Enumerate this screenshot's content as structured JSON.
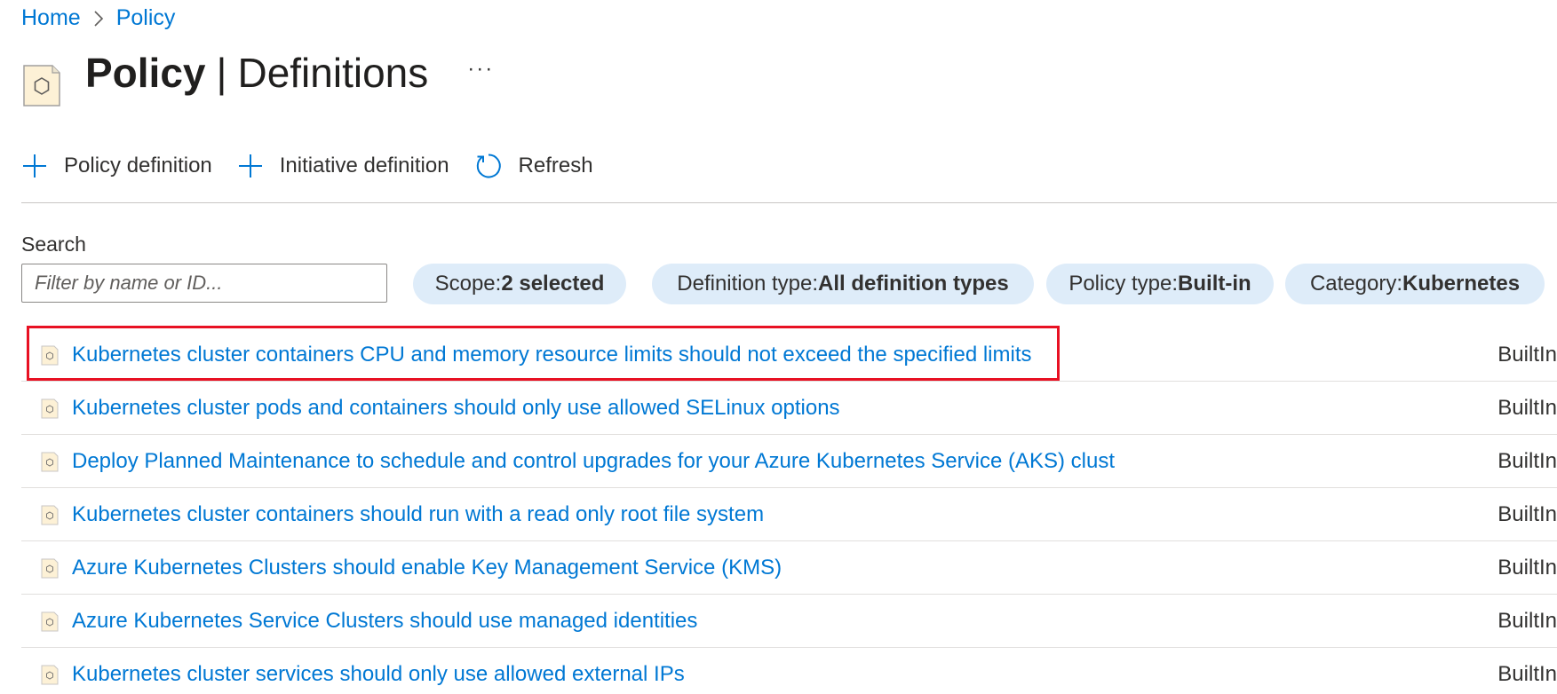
{
  "breadcrumb": {
    "home": "Home",
    "current": "Policy"
  },
  "header": {
    "title_bold": "Policy",
    "title_separator": "|",
    "title_rest": "Definitions",
    "more": "···",
    "icon": "policy-icon"
  },
  "toolbar": {
    "policy_definition": "Policy definition",
    "initiative_definition": "Initiative definition",
    "refresh": "Refresh"
  },
  "search": {
    "label": "Search",
    "placeholder": "Filter by name or ID..."
  },
  "filters": [
    {
      "name": "Scope",
      "sep": " : ",
      "value": "2 selected"
    },
    {
      "name": "Definition type",
      "sep": " : ",
      "value": "All definition types"
    },
    {
      "name": "Policy type",
      "sep": " : ",
      "value": "Built-in"
    },
    {
      "name": "Category",
      "sep": " : ",
      "value": "Kubernetes"
    }
  ],
  "definitions": [
    {
      "name": "Kubernetes cluster containers CPU and memory resource limits should not exceed the specified limits",
      "type": "BuiltIn",
      "highlighted": true
    },
    {
      "name": "Kubernetes cluster pods and containers should only use allowed SELinux options",
      "type": "BuiltIn"
    },
    {
      "name": "Deploy Planned Maintenance to schedule and control upgrades for your Azure Kubernetes Service (AKS) clust",
      "type": "BuiltIn"
    },
    {
      "name": "Kubernetes cluster containers should run with a read only root file system",
      "type": "BuiltIn"
    },
    {
      "name": "Azure Kubernetes Clusters should enable Key Management Service (KMS)",
      "type": "BuiltIn"
    },
    {
      "name": "Azure Kubernetes Service Clusters should use managed identities",
      "type": "BuiltIn"
    },
    {
      "name": "Kubernetes cluster services should only use allowed external IPs",
      "type": "BuiltIn"
    }
  ],
  "colors": {
    "link": "#0078d4",
    "pill_bg": "#deecf9",
    "highlight": "#e81123",
    "icon_fill": "#fdf1d6"
  }
}
